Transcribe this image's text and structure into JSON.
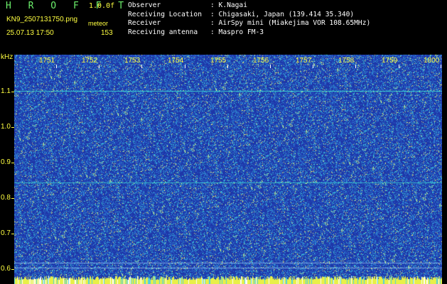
{
  "header": {
    "app_title": "H R O F F T",
    "version": "1.0.0f",
    "filename": "KN9_2507131750.png",
    "mode": "meteor",
    "timestamp": "25.07.13 17:50",
    "count": "153",
    "info_rows": [
      {
        "key": "Observer",
        "value": ": K.Nagai"
      },
      {
        "key": "Receiving Location",
        "value": ": Chigasaki, Japan (139.414 35.340)"
      },
      {
        "key": "Receiver",
        "value": ": AirSpy mini (Miakejima VOR 108.65MHz)"
      },
      {
        "key": "Receiving antenna",
        "value": ": Maspro FM-3"
      }
    ]
  },
  "axes": {
    "y_unit": "kHz",
    "x_ticks": [
      "1751",
      "1752",
      "1753",
      "1754",
      "1755",
      "1756",
      "1757",
      "1758",
      "1759",
      "1800"
    ],
    "y_ticks": [
      "1.1",
      "1.0",
      "0.9",
      "0.8",
      "0.7",
      "0.6"
    ]
  },
  "colors": {
    "background": "#1f39a8",
    "trace": "#3fe0d0",
    "label": "#ffff40",
    "title": "#6cf06c"
  }
}
